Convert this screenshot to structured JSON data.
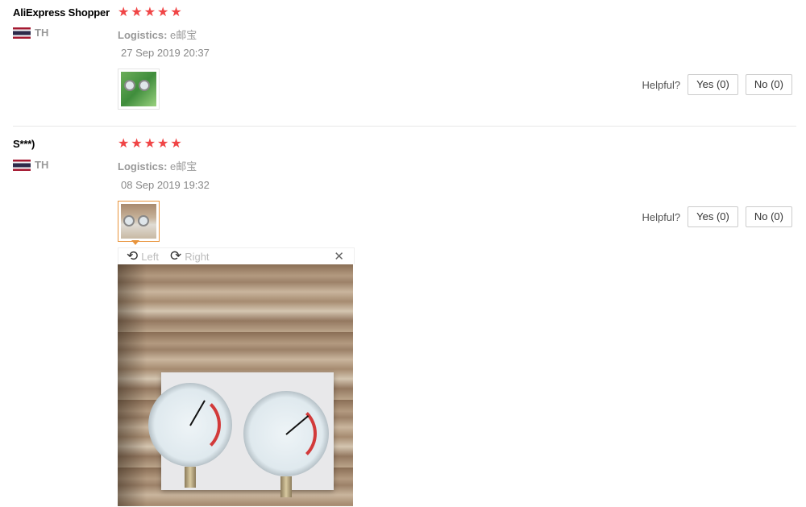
{
  "reviews": [
    {
      "buyer": "AliExpress Shopper",
      "country": "TH",
      "rating": 5,
      "logistics_label": "Logistics:",
      "logistics_value": "e邮宝",
      "date": "27 Sep 2019 20:37",
      "helpful_label": "Helpful?",
      "yes_label": "Yes (0)",
      "no_label": "No (0)"
    },
    {
      "buyer": "S***)",
      "country": "TH",
      "rating": 5,
      "logistics_label": "Logistics:",
      "logistics_value": "e邮宝",
      "date": "08 Sep 2019 19:32",
      "helpful_label": "Helpful?",
      "yes_label": "Yes (0)",
      "no_label": "No (0)"
    }
  ],
  "viewer": {
    "rotate_left_label": "Left",
    "rotate_right_label": "Right",
    "close_icon": "close-icon"
  },
  "colors": {
    "star": "#f04546",
    "selected_thumb_border": "#e8943c"
  }
}
